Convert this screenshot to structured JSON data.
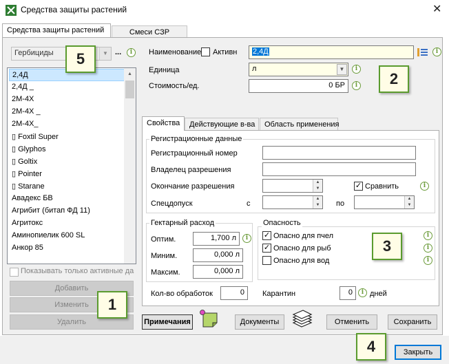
{
  "window": {
    "title": "Средства защиты растений",
    "close_glyph": "✕"
  },
  "main_tabs": [
    {
      "label": "Средства защиты растений",
      "active": true
    },
    {
      "label": "Смеси СЗР",
      "active": false
    }
  ],
  "left": {
    "filter_value": "Гербициды",
    "more_glyph": "...",
    "items": [
      {
        "label": "2,4Д",
        "selected": true
      },
      {
        "label": "2,4Д _",
        "selected": false
      },
      {
        "label": "2M-4X",
        "selected": false
      },
      {
        "label": "2M-4X _",
        "selected": false
      },
      {
        "label": "2M-4X_",
        "selected": false
      },
      {
        "label": "▯ Foxtil Super",
        "selected": false
      },
      {
        "label": "▯ Glyphos",
        "selected": false
      },
      {
        "label": "▯ Goltix",
        "selected": false
      },
      {
        "label": "▯ Pointer",
        "selected": false
      },
      {
        "label": "▯ Starane",
        "selected": false
      },
      {
        "label": "Авадекс БВ",
        "selected": false
      },
      {
        "label": "Агрибит (битап ФД 11)",
        "selected": false
      },
      {
        "label": "Агритокс",
        "selected": false
      },
      {
        "label": "Аминопиелик 600 SL",
        "selected": false
      },
      {
        "label": "Анкор 85",
        "selected": false
      }
    ],
    "show_active_label": "Показывать только активные да",
    "add_label": "Добавить",
    "edit_label": "Изменить",
    "delete_label": "Удалить"
  },
  "header": {
    "name_label": "Наименование",
    "active_label": "Активн",
    "name_value": "2,4Д",
    "unit_label": "Единица",
    "unit_value": "л",
    "cost_label": "Стоимость/ед.",
    "cost_value": "0 БР"
  },
  "inner_tabs": [
    {
      "label": "Свойства",
      "active": true
    },
    {
      "label": "Действующие в-ва",
      "active": false
    },
    {
      "label": "Область применения",
      "active": false
    }
  ],
  "registration": {
    "title": "Регистрационные данные",
    "reg_number_label": "Регистрационный номер",
    "owner_label": "Владелец разрешения",
    "expiry_label": "Окончание разрешения",
    "compare_label": "Сравнить",
    "special_label": "Спецдопуск",
    "from_label": "с",
    "to_label": "по"
  },
  "hectare": {
    "title": "Гектарный расход",
    "optim_label": "Оптим.",
    "optim_value": "1,700 л",
    "min_label": "Миним.",
    "min_value": "0,000 л",
    "max_label": "Максим.",
    "max_value": "0,000 л"
  },
  "danger": {
    "title": "Опасность",
    "bees_label": "Опасно для пчел",
    "fish_label": "Опасно для рыб",
    "water_label": "Опасно для вод"
  },
  "treatments": {
    "count_label": "Кол-во обработок",
    "count_value": "0",
    "quarantine_label": "Карантин",
    "quarantine_value": "0",
    "days_label": "дней"
  },
  "buttons": {
    "notes": "Примечания",
    "documents": "Документы",
    "cancel": "Отменить",
    "save": "Сохранить",
    "close": "Закрыть"
  },
  "callouts": [
    "1",
    "2",
    "3",
    "4",
    "5"
  ],
  "info_glyph": "i",
  "check_glyph": "✓",
  "colors": {
    "selection": "#cce8ff",
    "name_highlight": "#0078d7",
    "callout_border": "#5a9b2e",
    "info_green": "#6b9b3a"
  }
}
